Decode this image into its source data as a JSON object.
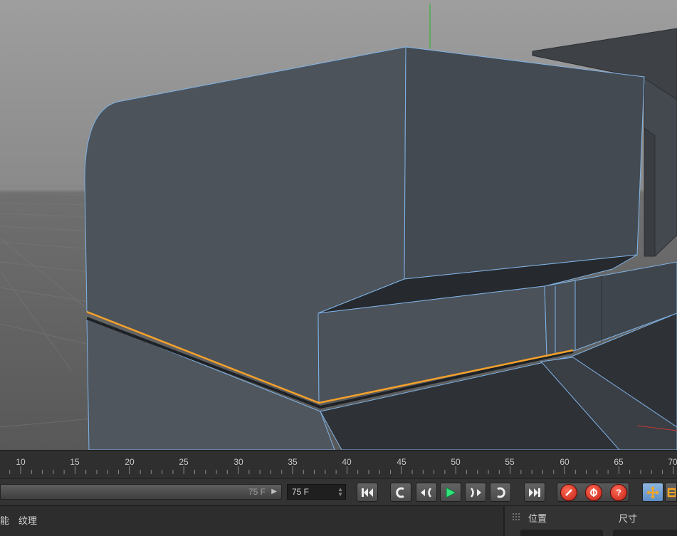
{
  "timeline": {
    "ticks": [
      "10",
      "15",
      "20",
      "25",
      "30",
      "35",
      "40",
      "45",
      "50",
      "55",
      "60",
      "65",
      "70"
    ]
  },
  "transport": {
    "slider_value": "75 F",
    "slider_arrow_icon": "play-small-icon",
    "frame_field": "75 F",
    "buttons": [
      "go-to-start",
      "step-back-key",
      "step-back-frame",
      "play",
      "step-forward-frame",
      "step-forward-key",
      "go-to-end"
    ],
    "keyframe_buttons": [
      "record-icon",
      "autokey-icon",
      "keyframe-selection-icon"
    ],
    "play_color": "#2ee67a",
    "red_color": "#e5341f",
    "orange_color": "#f5a623"
  },
  "attributes": {
    "tab_partial": "能",
    "tab_texture": "纹理"
  },
  "coordinates": {
    "position_label": "位置",
    "size_label": "尺寸"
  },
  "viewport": {
    "selection_color": "#f5a12a",
    "edge_color": "#7fb3e6"
  }
}
